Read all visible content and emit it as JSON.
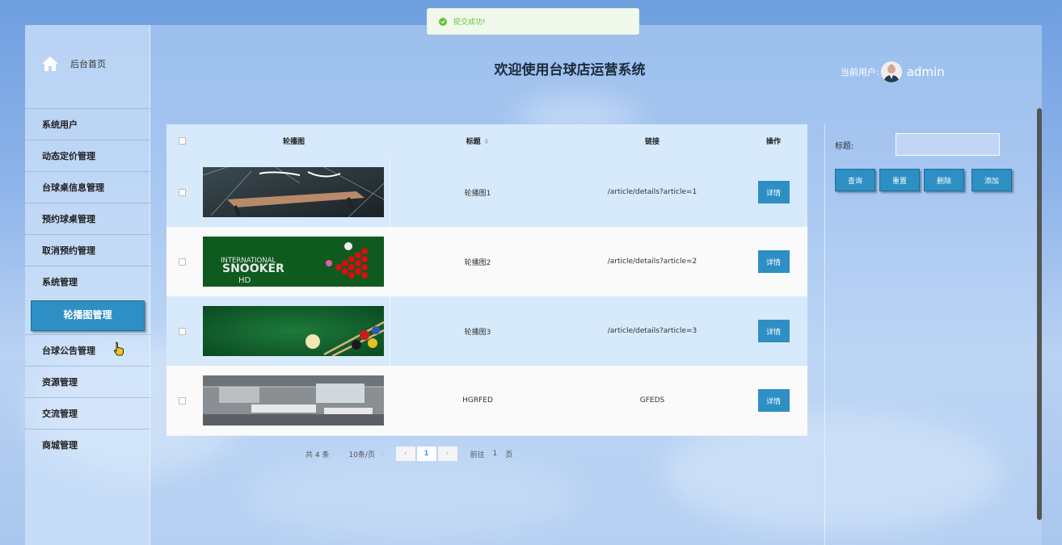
{
  "toast": {
    "message": "提交成功!"
  },
  "header": {
    "title": "欢迎使用台球店运营系统",
    "user_label": "当前用户:",
    "username": "admin"
  },
  "sidebar": {
    "home_label": "后台首页",
    "items": [
      {
        "label": "系统用户"
      },
      {
        "label": "动态定价管理"
      },
      {
        "label": "台球桌信息管理"
      },
      {
        "label": "预约球桌管理"
      },
      {
        "label": "取消预约管理"
      },
      {
        "label": "系统管理"
      }
    ],
    "active_sub": "轮播图管理",
    "items_after": [
      {
        "label": "台球公告管理"
      },
      {
        "label": "资源管理"
      },
      {
        "label": "交流管理"
      },
      {
        "label": "商城管理"
      }
    ]
  },
  "table": {
    "columns": [
      "轮播图",
      "标题",
      "链接",
      "操作"
    ],
    "rows": [
      {
        "title": "轮播图1",
        "link": "/article/details?article=1",
        "action": "详情",
        "image": "pool-table-ink"
      },
      {
        "title": "轮播图2",
        "link": "/article/details?article=2",
        "action": "详情",
        "image": "snooker-banner",
        "image_text": [
          "INTERNATIONAL",
          "SNOOKER",
          "HD"
        ]
      },
      {
        "title": "轮播图3",
        "link": "/article/details?article=3",
        "action": "详情",
        "image": "billiard-balls-green"
      },
      {
        "title": "HGRFED",
        "link": "GFEDS",
        "action": "详情",
        "image": "office-room"
      }
    ]
  },
  "pagination": {
    "total": "共 4 条",
    "page_size": "10条/页",
    "current": "1",
    "goto_prefix": "前往",
    "goto_value": "1",
    "goto_suffix": "页"
  },
  "search": {
    "label": "标题:",
    "value": ""
  },
  "actions": {
    "query": "查询",
    "reset": "重置",
    "delete": "删除",
    "add": "添加"
  },
  "colors": {
    "primary": "#2d8fc4",
    "success": "#67c23a",
    "row_alt": "#d6eafb"
  }
}
